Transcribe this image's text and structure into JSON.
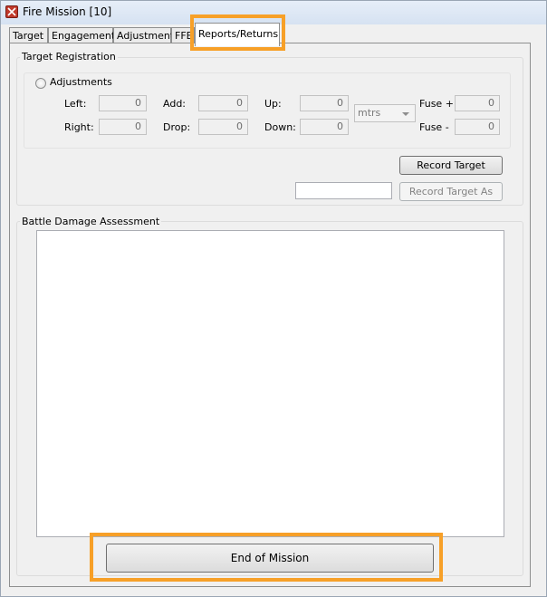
{
  "window": {
    "title": "Fire Mission [10]"
  },
  "tabs": [
    {
      "label": "Target"
    },
    {
      "label": "Engagement"
    },
    {
      "label": "Adjustment"
    },
    {
      "label": "FFE"
    },
    {
      "label": "Reports/Returns"
    }
  ],
  "target_registration": {
    "title": "Target Registration",
    "adjustments_label": "Adjustments",
    "left": {
      "label": "Left:",
      "value": "0"
    },
    "add": {
      "label": "Add:",
      "value": "0"
    },
    "up": {
      "label": "Up:",
      "value": "0"
    },
    "right": {
      "label": "Right:",
      "value": "0"
    },
    "drop": {
      "label": "Drop:",
      "value": "0"
    },
    "down": {
      "label": "Down:",
      "value": "0"
    },
    "units": "mtrs",
    "fuse_plus": {
      "label": "Fuse +",
      "value": "0"
    },
    "fuse_minus": {
      "label": "Fuse -",
      "value": "0"
    },
    "record_target_label": "Record Target",
    "record_target_as_label": "Record Target As",
    "record_target_name": ""
  },
  "bda": {
    "title": "Battle Damage Assessment",
    "text": ""
  },
  "end_of_mission_label": "End of Mission",
  "highlight_color": "#f7a028"
}
